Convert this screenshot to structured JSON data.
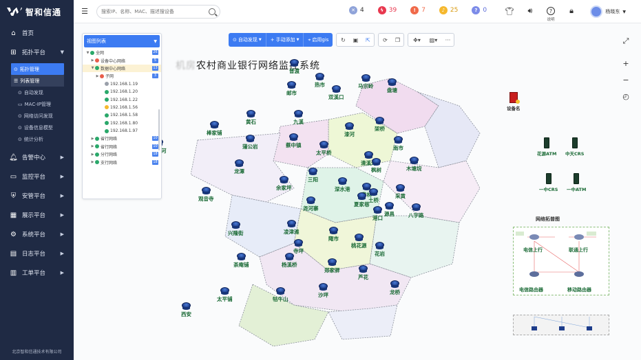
{
  "app": {
    "logo_text": "智和信通",
    "copyright": "北京智和信通技术有限公司"
  },
  "sidebar": {
    "items": [
      {
        "label": "首页",
        "icon": "home-icon"
      },
      {
        "label": "拓扑平台",
        "icon": "topology-icon",
        "expanded": true
      },
      {
        "label": "告警中心",
        "icon": "bell-icon"
      },
      {
        "label": "监控平台",
        "icon": "monitor-icon"
      },
      {
        "label": "安管平台",
        "icon": "shield-icon"
      },
      {
        "label": "展示平台",
        "icon": "grid-icon"
      },
      {
        "label": "系统平台",
        "icon": "gear-icon"
      },
      {
        "label": "日志平台",
        "icon": "log-icon"
      },
      {
        "label": "工单平台",
        "icon": "ticket-icon"
      }
    ],
    "topology_sub": [
      "拓扑管理",
      "列表管理"
    ],
    "topology_subsub": [
      "自动发现",
      "MAC-IP管理",
      "网络访问发现",
      "设备信息模型",
      "统计分析"
    ]
  },
  "header": {
    "search_placeholder": "搜索IP、名称、MAC、描述搜设备",
    "alerts": [
      {
        "count": "4",
        "color": "#8fa3d9",
        "icon": "x-icon"
      },
      {
        "count": "39",
        "color": "#e8384f",
        "icon": "bolt-icon"
      },
      {
        "count": "7",
        "color": "#f06a4a",
        "icon": "exclaim-icon"
      },
      {
        "count": "25",
        "color": "#f5b82e",
        "icon": "bell-icon"
      },
      {
        "count": "0",
        "color": "#7c8be8",
        "icon": "question-icon"
      }
    ],
    "help_label": "说明",
    "user_name": "杨晓东"
  },
  "view_panel": {
    "title": "视图列表",
    "rows": [
      {
        "label": "全网",
        "count": "26",
        "level": 0,
        "color": "#2aa86a",
        "toggle": "▼"
      },
      {
        "label": "设备中心网络",
        "count": "5",
        "level": 1,
        "color": "#e85d4a",
        "toggle": "▶"
      },
      {
        "label": "数据中心网络",
        "count": "13",
        "level": 1,
        "color": "#2aa86a",
        "toggle": "▼",
        "selected": true
      },
      {
        "label": "子网",
        "count": "3",
        "level": 2,
        "color": "#e85d4a",
        "toggle": "▶"
      },
      {
        "label": "192.168.1.19",
        "count": "",
        "level": 3,
        "color": "#9aa0aa",
        "toggle": ""
      },
      {
        "label": "192.168.1.20",
        "count": "",
        "level": 3,
        "color": "#2aa86a",
        "toggle": ""
      },
      {
        "label": "192.168.1.22",
        "count": "",
        "level": 3,
        "color": "#2aa86a",
        "toggle": ""
      },
      {
        "label": "192.168.1.56",
        "count": "",
        "level": 3,
        "color": "#f5b82e",
        "toggle": ""
      },
      {
        "label": "192.168.1.58",
        "count": "",
        "level": 3,
        "color": "#2aa86a",
        "toggle": ""
      },
      {
        "label": "192.168.1.80",
        "count": "",
        "level": 3,
        "color": "#2aa86a",
        "toggle": ""
      },
      {
        "label": "192.168.1.97",
        "count": "",
        "level": 3,
        "color": "#2aa86a",
        "toggle": ""
      },
      {
        "label": "省行网络",
        "count": "10",
        "level": 1,
        "color": "#2aa86a",
        "toggle": "▶"
      },
      {
        "label": "省行网络",
        "count": "10",
        "level": 1,
        "color": "#2aa86a",
        "toggle": "▶"
      },
      {
        "label": "分行网络",
        "count": "18",
        "level": 1,
        "color": "#2aa86a",
        "toggle": "▶"
      },
      {
        "label": "支行网络",
        "count": "18",
        "level": 1,
        "color": "#2aa86a",
        "toggle": "▶"
      }
    ]
  },
  "toolbar": {
    "auto_discover": "自动发现",
    "manual_add": "手动添加",
    "enable_gis": "启用gis"
  },
  "map": {
    "title_prefix": "机房",
    "title": "农村商业银行网络监控系统",
    "nodes": [
      {
        "label": "普渡"
      },
      {
        "label": "热市"
      },
      {
        "label": "邮市"
      },
      {
        "label": "双溪口"
      },
      {
        "label": "马宗岭"
      },
      {
        "label": "盘塘"
      },
      {
        "label": "黄石"
      },
      {
        "label": "九溪"
      },
      {
        "label": "漆河"
      },
      {
        "label": "架桥"
      },
      {
        "label": "棒家铺"
      },
      {
        "label": "蒲公岩"
      },
      {
        "label": "蔡中镇"
      },
      {
        "label": "太平桥"
      },
      {
        "label": "南市"
      },
      {
        "label": "牛车河"
      },
      {
        "label": "清溪河"
      },
      {
        "label": "枫树"
      },
      {
        "label": "木塘垸"
      },
      {
        "label": "龙潭"
      },
      {
        "label": "余家坪"
      },
      {
        "label": "三阳"
      },
      {
        "label": "深水港"
      },
      {
        "label": "青林"
      },
      {
        "label": "土桥"
      },
      {
        "label": "观音寺"
      },
      {
        "label": "尧河寨"
      },
      {
        "label": "夏家巷"
      },
      {
        "label": "采黄"
      },
      {
        "label": "源昌"
      },
      {
        "label": "港口"
      },
      {
        "label": "八宇路"
      },
      {
        "label": "兴隆街"
      },
      {
        "label": "凌津滩"
      },
      {
        "label": "陬市"
      },
      {
        "label": "桃花源"
      },
      {
        "label": "茶庵铺"
      },
      {
        "label": "杨溪桥"
      },
      {
        "label": "郑家驿"
      },
      {
        "label": "芦花"
      },
      {
        "label": "太平铺"
      },
      {
        "label": "沙坪"
      },
      {
        "label": "牯牛山"
      },
      {
        "label": "西安"
      },
      {
        "label": "寺坪"
      },
      {
        "label": "花岩"
      },
      {
        "label": "龙桥"
      }
    ],
    "alarm_device_label": "设备名",
    "devices": [
      {
        "label": "花源ATM"
      },
      {
        "label": "中天CRS"
      },
      {
        "label": "一中CRS"
      },
      {
        "label": "一中ATM"
      }
    ],
    "topology_title": "网络拓普图",
    "topo_labels": [
      "电信上行",
      "联通上行",
      "电信路由器",
      "移动路由器"
    ]
  }
}
